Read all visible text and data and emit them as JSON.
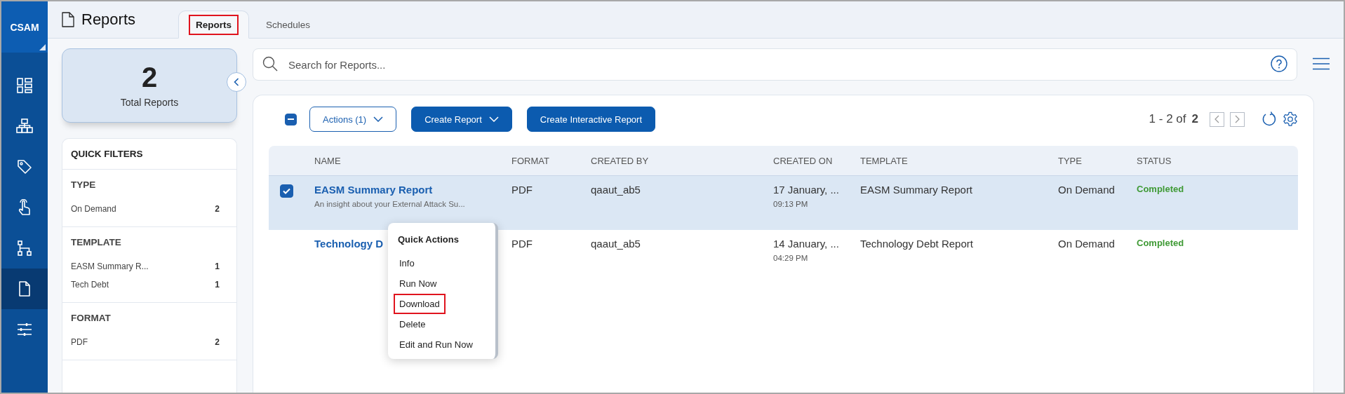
{
  "app": {
    "logo": "CSAM"
  },
  "sidebar": {
    "items": [
      {
        "selected": false
      },
      {
        "selected": false
      },
      {
        "selected": false
      },
      {
        "selected": false
      },
      {
        "selected": false
      },
      {
        "selected": true
      },
      {
        "selected": false
      }
    ]
  },
  "header": {
    "title": "Reports",
    "tabs": [
      {
        "label": "Reports",
        "selected": true,
        "highlighted": true
      },
      {
        "label": "Schedules",
        "selected": false,
        "highlighted": false
      }
    ]
  },
  "summary": {
    "count": "2",
    "label": "Total Reports"
  },
  "quick_filters": {
    "title": "QUICK FILTERS",
    "groups": [
      {
        "title": "TYPE",
        "items": [
          {
            "label": "On Demand",
            "count": "2"
          }
        ]
      },
      {
        "title": "TEMPLATE",
        "items": [
          {
            "label": "EASM Summary R...",
            "count": "1"
          },
          {
            "label": "Tech Debt",
            "count": "1"
          }
        ]
      },
      {
        "title": "FORMAT",
        "items": [
          {
            "label": "PDF",
            "count": "2"
          }
        ]
      }
    ]
  },
  "search": {
    "placeholder": "Search for Reports..."
  },
  "toolbar": {
    "select_all": {
      "indeterminate": true
    },
    "buttons": [
      {
        "label": "Actions (1)",
        "kind": "outline",
        "dropdown": true
      },
      {
        "label": "Create Report",
        "kind": "primary",
        "dropdown": true
      },
      {
        "label": "Create Interactive Report",
        "kind": "primary",
        "dropdown": false
      }
    ],
    "pagination": {
      "range": "1 - 2 of",
      "total": "2"
    }
  },
  "table": {
    "columns": [
      "NAME",
      "FORMAT",
      "CREATED BY",
      "CREATED ON",
      "TEMPLATE",
      "TYPE",
      "STATUS"
    ],
    "rows": [
      {
        "selected": true,
        "name": "EASM Summary Report",
        "description": "An insight about your External Attack Su...",
        "format": "PDF",
        "created_by": "qaaut_ab5",
        "created_on": "17 January, ...",
        "created_time": "09:13 PM",
        "template": "EASM Summary Report",
        "type": "On Demand",
        "status": "Completed"
      },
      {
        "selected": false,
        "name": "Technology D",
        "format": "PDF",
        "created_by": "qaaut_ab5",
        "created_on": "14 January, ...",
        "created_time": "04:29 PM",
        "template": "Technology Debt Report",
        "type": "On Demand",
        "status": "Completed"
      }
    ]
  },
  "quick_menu": {
    "title": "Quick Actions",
    "items": [
      {
        "label": "Info",
        "highlighted": false
      },
      {
        "label": "Run Now",
        "highlighted": false
      },
      {
        "label": "Download",
        "highlighted": true
      },
      {
        "label": "Delete",
        "highlighted": false
      },
      {
        "label": "Edit and Run Now",
        "highlighted": false
      }
    ]
  }
}
